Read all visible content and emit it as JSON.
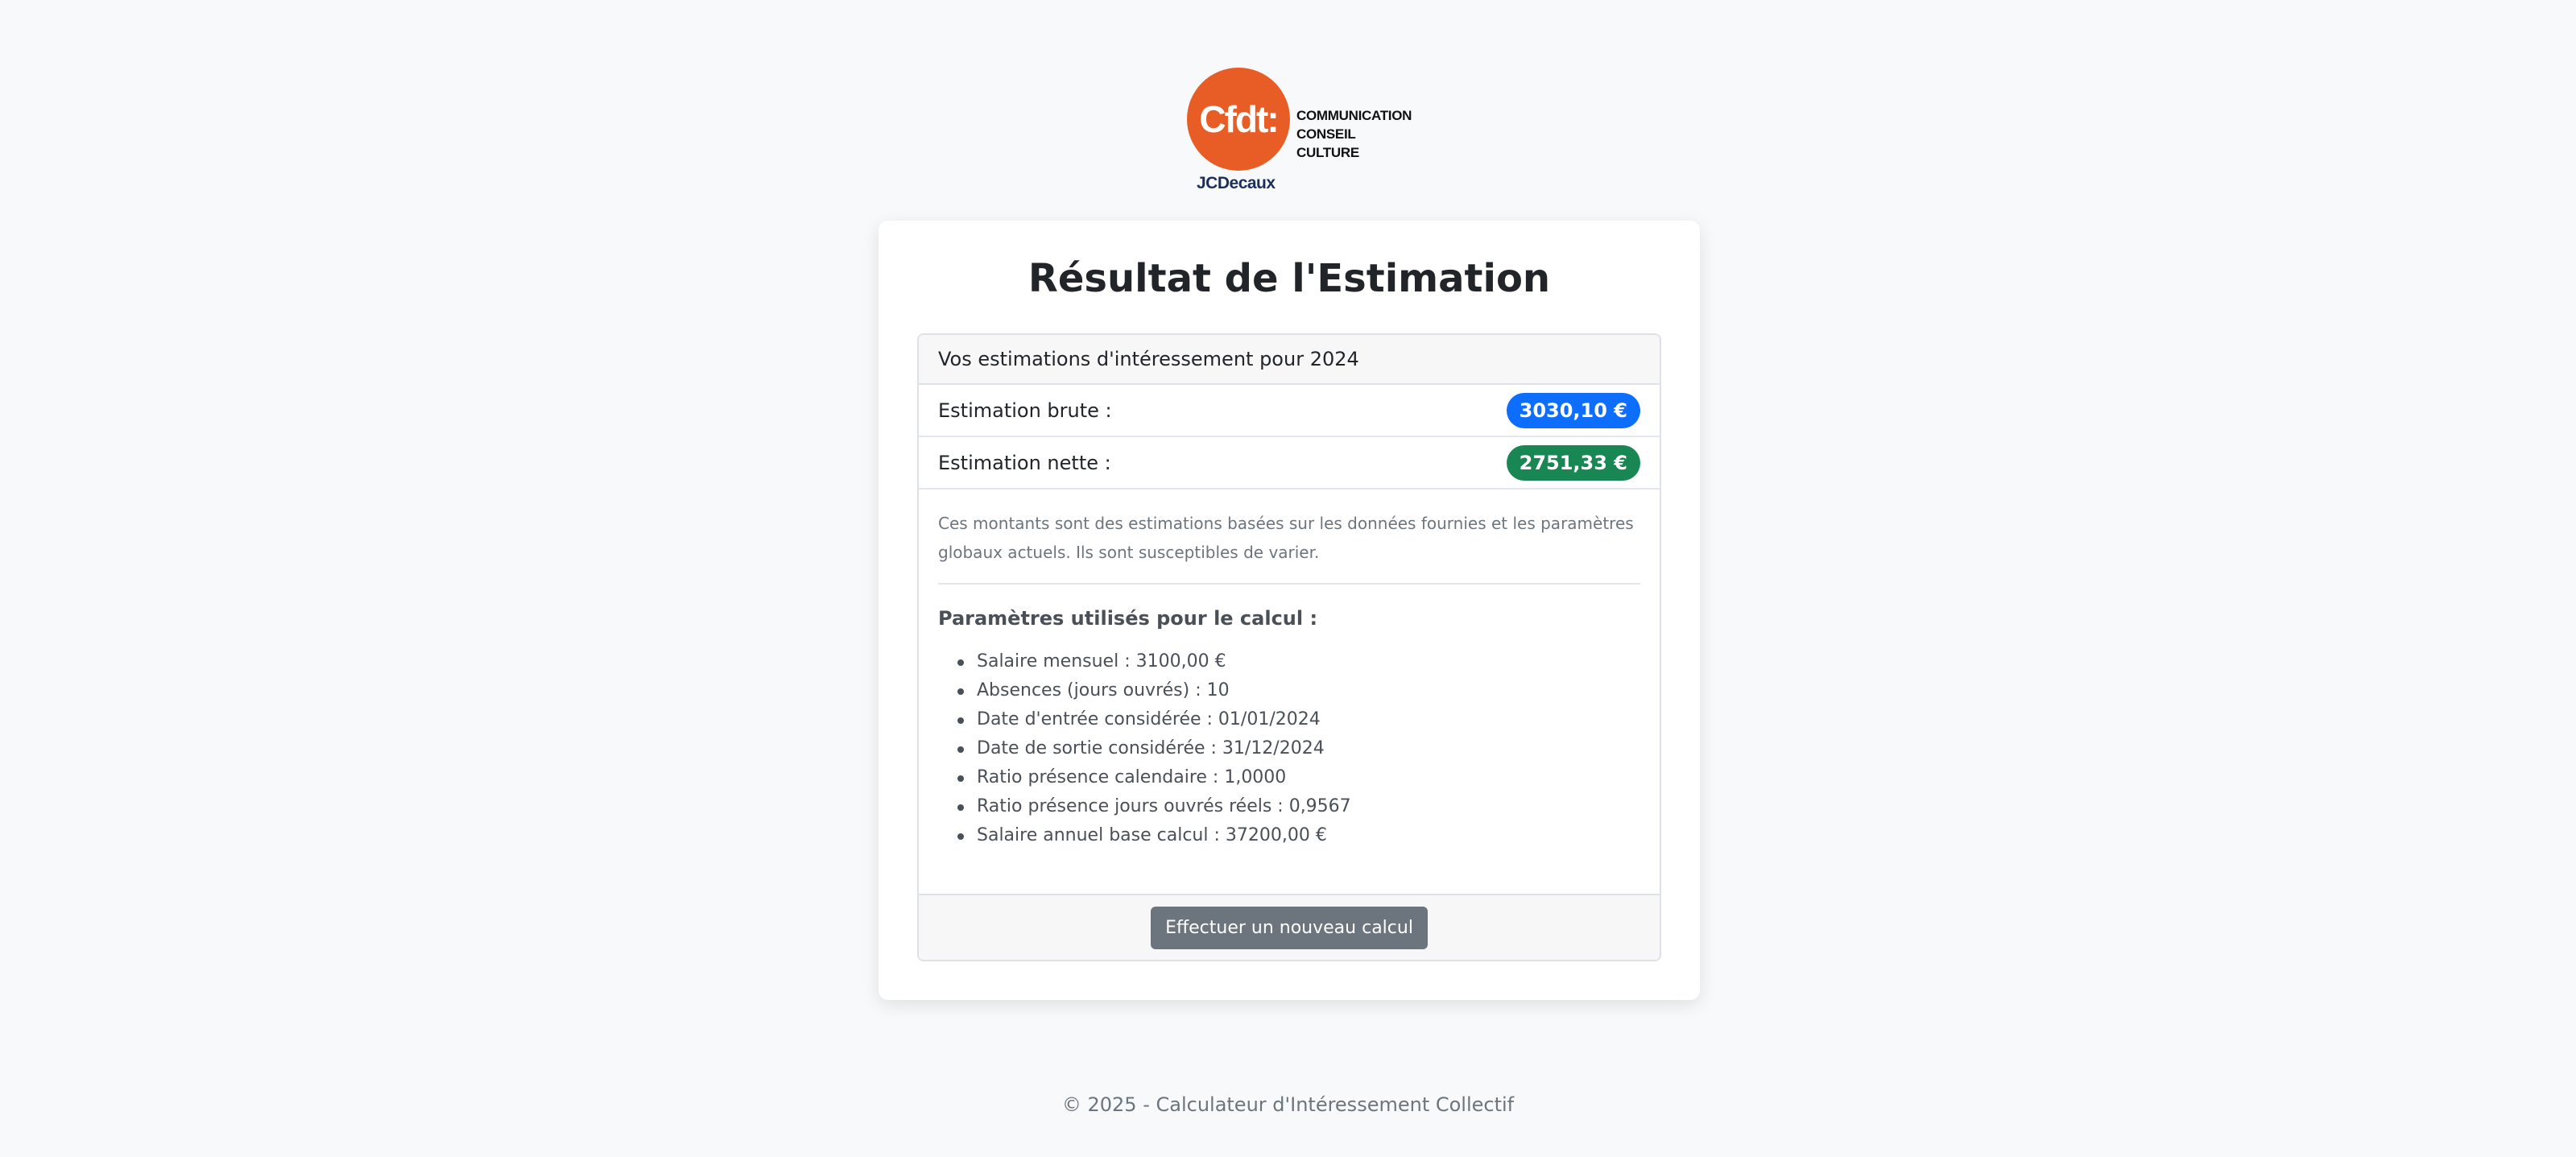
{
  "logo": {
    "mark_text": "Cfdt:",
    "side_line_1": "COMMUNICATION",
    "side_line_2": "CONSEIL CULTURE",
    "sub_text": "JCDecaux"
  },
  "card": {
    "title": "Résultat de l'Estimation",
    "header": "Vos estimations d'intéressement pour 2024",
    "rows": [
      {
        "label": "Estimation brute :",
        "value": "3030,10 €",
        "color": "#0d6efd"
      },
      {
        "label": "Estimation nette :",
        "value": "2751,33 €",
        "color": "#198754"
      }
    ],
    "note": "Ces montants sont des estimations basées sur les données fournies et les paramètres globaux actuels. Ils sont susceptibles de varier.",
    "params_title": "Paramètres utilisés pour le calcul :",
    "params": [
      "Salaire mensuel : 3100,00 €",
      "Absences (jours ouvrés) : 10",
      "Date d'entrée considérée : 01/01/2024",
      "Date de sortie considérée : 31/12/2024",
      "Ratio présence calendaire : 1,0000",
      "Ratio présence jours ouvrés réels : 0,9567",
      "Salaire annuel base calcul : 37200,00 €"
    ],
    "button_label": "Effectuer un nouveau calcul"
  },
  "footer": {
    "text": "© 2025 - Calculateur d'Intéressement Collectif"
  }
}
